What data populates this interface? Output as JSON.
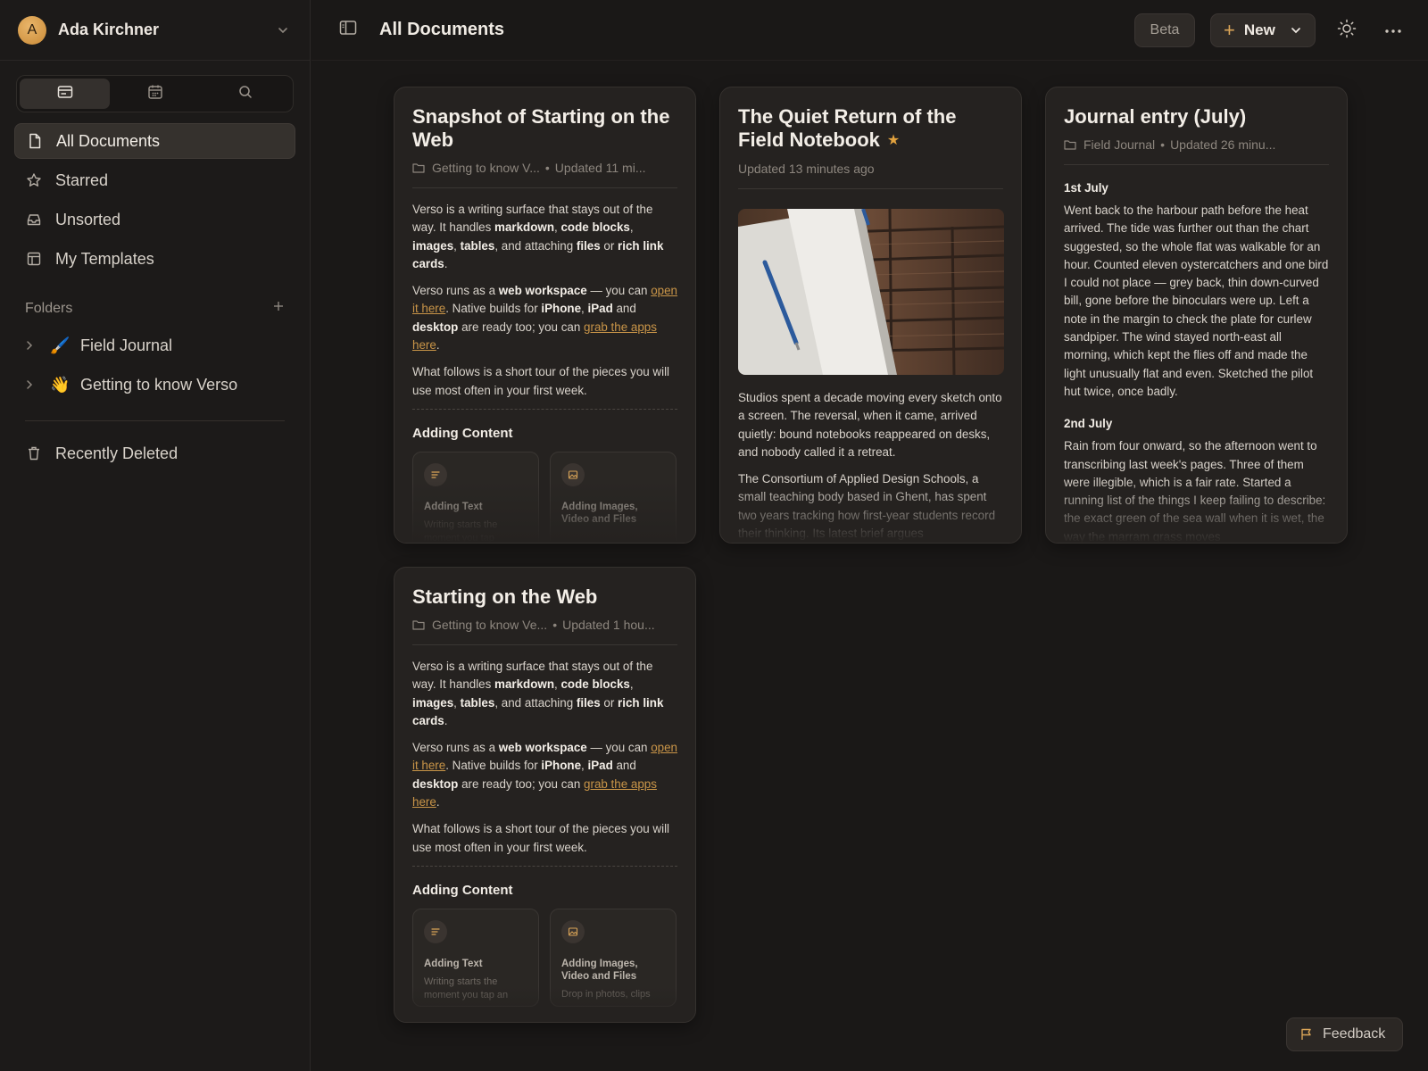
{
  "user": {
    "initial": "A",
    "name": "Ada Kirchner"
  },
  "sidebar": {
    "views": [
      {
        "icon": "cards-icon"
      },
      {
        "icon": "calendar-icon"
      },
      {
        "icon": "search-icon"
      }
    ],
    "nav": [
      {
        "label": "All Documents",
        "icon": "document-icon"
      },
      {
        "label": "Starred",
        "icon": "star-icon"
      },
      {
        "label": "Unsorted",
        "icon": "inbox-icon"
      },
      {
        "label": "My Templates",
        "icon": "template-icon"
      }
    ],
    "folders_label": "Folders",
    "folders": [
      {
        "emoji": "🖌️",
        "label": "Field Journal"
      },
      {
        "emoji": "👋",
        "label": "Getting to know Verso"
      }
    ],
    "recently_deleted": "Recently Deleted"
  },
  "topbar": {
    "title": "All Documents",
    "beta": "Beta",
    "new_label": "New"
  },
  "cards": {
    "snapshot": {
      "title": "Snapshot of Starting on the Web",
      "folder": "Getting to know V...",
      "updated": "Updated 11 mi...",
      "section": "Adding Content",
      "tile1_label": "Adding Text",
      "tile1_sub": "Writing starts the moment you tap",
      "tile2_label": "Adding Images, Video and Files"
    },
    "quiet": {
      "title": "The Quiet Return of the Field Notebook",
      "updated": "Updated 13 minutes ago",
      "p1": "Studios spent a decade moving every sketch onto a screen. The reversal, when it came, arrived quietly: bound notebooks reappeared on desks, and nobody called it a retreat.",
      "p2": "The Consortium of Applied Design Schools, a small teaching body based in Ghent, has spent two years tracking how first-year students record their thinking. Its latest brief argues"
    },
    "journal": {
      "title": "Journal entry (July)",
      "folder": "Field Journal",
      "updated": "Updated 26 minu...",
      "h1": "1st July",
      "p1": "Went back to the harbour path before the heat arrived. The tide was further out than the chart suggested, so the whole flat was walkable for an hour. Counted eleven oystercatchers and one bird I could not place — grey back, thin down-curved bill, gone before the binoculars were up. Left a note in the margin to check the plate for curlew sandpiper. The wind stayed north-east all morning, which kept the flies off and made the light unusually flat and even. Sketched the pilot hut twice, once badly.",
      "h2": "2nd July",
      "p2": "Rain from four onward, so the afternoon went to transcribing last week's pages. Three of them were illegible, which is a fair rate. Started a running list of the things I keep failing to describe: the exact green of the sea wall when it is wet, the way the marram grass moves"
    },
    "starting": {
      "title": "Starting on the Web",
      "folder": "Getting to know Ve...",
      "updated": "Updated 1 hou...",
      "section": "Adding Content",
      "tile1_label": "Adding Text",
      "tile1_sub": "Writing starts the moment you tap an",
      "tile2_label": "Adding Images, Video and Files",
      "tile2_sub": "Drop in photos, clips"
    },
    "shared": {
      "p1_a": "Verso is a writing surface that stays out of the way. It handles ",
      "markdown": "markdown",
      "comma": ", ",
      "code_blocks": "code blocks",
      "images": "images",
      "tables": "tables",
      "and_attaching": ", and attaching ",
      "files": "files",
      "or": " or ",
      "rich_link_cards": "rich link cards",
      "period": ".",
      "p2_a": "Verso runs as a ",
      "web_workspace": "web workspace",
      "p2_b": " — you can ",
      "open_it_here": "open it here",
      "p2_c": ". Native builds for ",
      "iphone": "iPhone",
      "ipad": "iPad",
      "and": " and ",
      "desktop": "desktop",
      "p2_d": " are ready too; you can ",
      "grab_apps": "grab the apps here",
      "p3": "What follows is a short tour of the pieces you will use most often in your first week."
    }
  },
  "feedback": "Feedback",
  "colors": {
    "accent": "#d9a457",
    "star": "#e2a23e",
    "link": "#c99548"
  }
}
